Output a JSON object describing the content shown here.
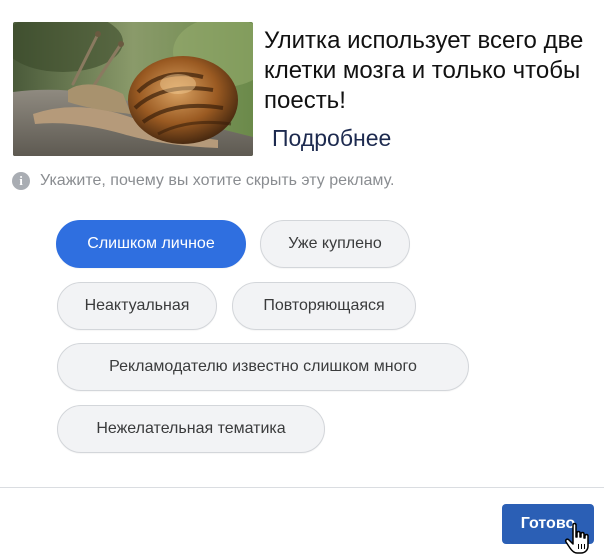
{
  "ad": {
    "image_alt": "snail-photo",
    "headline": "Улитка использует всего две клетки мозга и только чтобы поесть!",
    "learn_more": "Подробнее"
  },
  "prompt": {
    "icon": "info-icon",
    "text": "Укажите, почему вы хотите скрыть эту рекламу."
  },
  "reasons": [
    {
      "label": "Слишком личное",
      "selected": true
    },
    {
      "label": "Уже куплено",
      "selected": false
    },
    {
      "label": "Неактуальная",
      "selected": false
    },
    {
      "label": "Повторяющаяся",
      "selected": false
    },
    {
      "label": "Рекламодателю известно слишком много",
      "selected": false
    },
    {
      "label": "Нежелательная тематика",
      "selected": false
    }
  ],
  "footer": {
    "done_label": "Готово"
  },
  "colors": {
    "selected_chip": "#2f6fe0",
    "chip_bg": "#f2f3f5",
    "done_button": "#2b5fb5",
    "prompt_text": "#8a8d91"
  },
  "cursor": "hand-pointer-icon"
}
